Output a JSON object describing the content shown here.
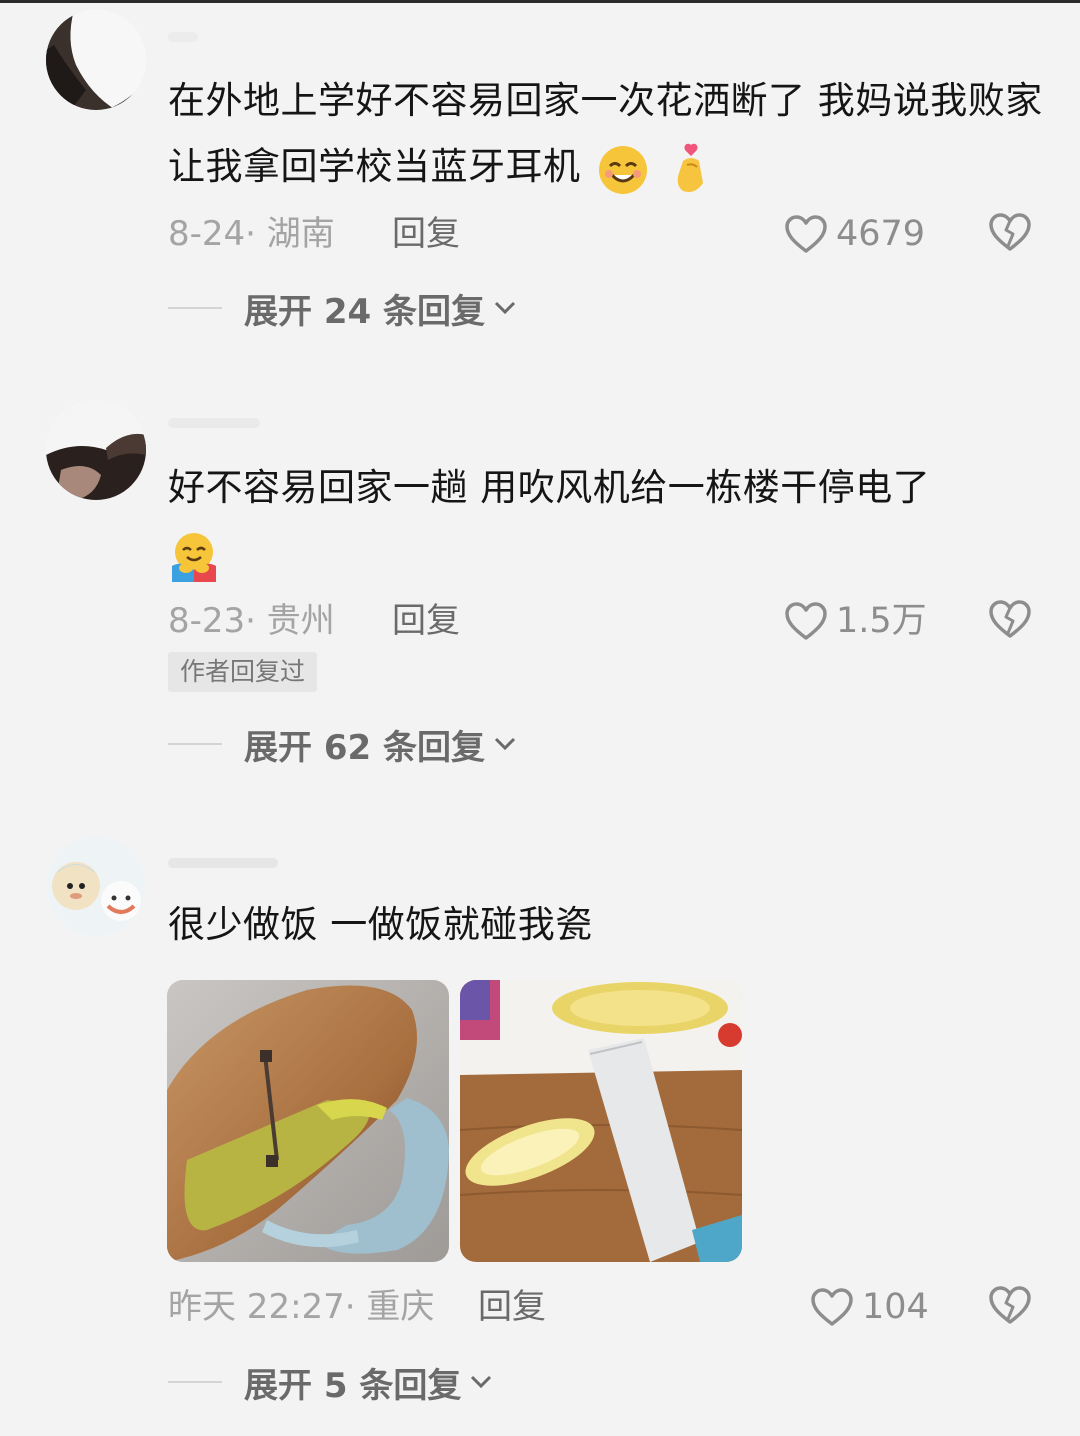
{
  "comments": [
    {
      "text": "在外地上学好不容易回家一次花洒断了 我妈说我败家 让我拿回学校当蓝牙耳机",
      "emojis": [
        "smiling-face-icon",
        "heart-hands-icon"
      ],
      "date": "8-24",
      "location": "湖南",
      "reply_label": "回复",
      "likes": "4679",
      "expand_label": "展开 24 条回复"
    },
    {
      "text": "好不容易回家一趟 用吹风机给一栋楼干停电了",
      "emojis": [
        "hugging-face-icon"
      ],
      "date": "8-23",
      "location": "贵州",
      "reply_label": "回复",
      "likes": "1.5万",
      "badge": "作者回复过",
      "expand_label": "展开 62 条回复"
    },
    {
      "text": "很少做饭 一做饭就碰我瓷",
      "date": "昨天 22:27",
      "location": "重庆",
      "reply_label": "回复",
      "likes": "104",
      "expand_label": "展开 5 条回复",
      "images": [
        "broken-peeler-with-sweet-potato-photo",
        "corn-and-knife-on-cutting-board-photo"
      ]
    }
  ],
  "colors": {
    "background": "#f3f3f3",
    "text": "#151515",
    "meta": "#a4a4a4",
    "secondary": "#6a6a6a"
  }
}
